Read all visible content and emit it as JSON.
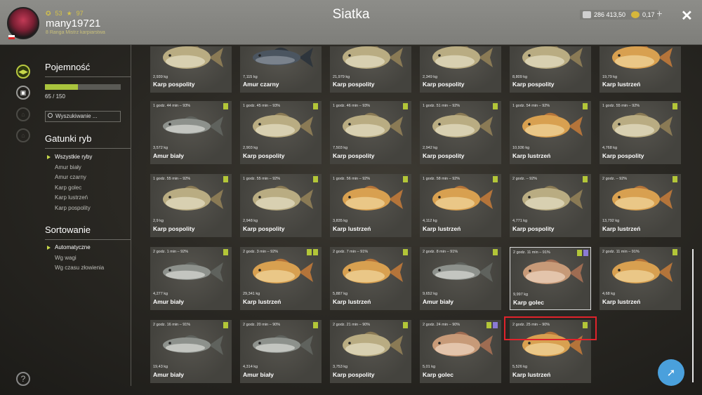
{
  "header": {
    "stat1": "53",
    "stat2": "97",
    "username": "many19721",
    "rank": "8 Ranga Mistrz karpiarstwa",
    "title": "Siatka",
    "silver": "286 413,50",
    "gold": "0,17",
    "plus": "+",
    "close": "✕"
  },
  "sidebar": {
    "capacity_title": "Pojemność",
    "capacity_count": "65 / 150",
    "capacity_fraction": 0.4333,
    "search_placeholder": "Wyszukiwanie ...",
    "species_title": "Gatunki ryb",
    "species": [
      "Wszystkie ryby",
      "Amur biały",
      "Amur czarny",
      "Karp golec",
      "Karp lustrzeń",
      "Karp pospolity"
    ],
    "sort_title": "Sortowanie",
    "sorts": [
      "Automatyczne",
      "Wg wagi",
      "Wg czasu złowienia"
    ]
  },
  "colors": {
    "accent": "#b3c638",
    "purple": "#8b7ad4",
    "highlight": "#e0232b",
    "fab": "#4aa0dc"
  },
  "cards": [
    {
      "time": "",
      "weight": "2,939 kg",
      "name": "Karp pospolity",
      "fish": "common",
      "tags": []
    },
    {
      "time": "",
      "weight": "7,115 kg",
      "name": "Amur czarny",
      "fish": "black",
      "tags": []
    },
    {
      "time": "",
      "weight": "21,979 kg",
      "name": "Karp pospolity",
      "fish": "common",
      "tags": []
    },
    {
      "time": "",
      "weight": "2,349 kg",
      "name": "Karp pospolity",
      "fish": "common",
      "tags": []
    },
    {
      "time": "",
      "weight": "8,809 kg",
      "name": "Karp pospolity",
      "fish": "common",
      "tags": []
    },
    {
      "time": "",
      "weight": "19,79 kg",
      "name": "Karp lustrzeń",
      "fish": "mirror",
      "tags": []
    },
    {
      "time": "1 godz. 44 min – 93%",
      "weight": "3,572 kg",
      "name": "Amur biały",
      "fish": "grass",
      "tags": [
        "g"
      ]
    },
    {
      "time": "1 godz. 45 min – 93%",
      "weight": "2,903 kg",
      "name": "Karp pospolity",
      "fish": "common",
      "tags": [
        "g"
      ]
    },
    {
      "time": "1 godz. 46 min – 93%",
      "weight": "7,503 kg",
      "name": "Karp pospolity",
      "fish": "common",
      "tags": [
        "g"
      ]
    },
    {
      "time": "1 godz. 51 min – 92%",
      "weight": "2,942 kg",
      "name": "Karp pospolity",
      "fish": "common",
      "tags": [
        "g"
      ]
    },
    {
      "time": "1 godz. 54 min – 92%",
      "weight": "10,936 kg",
      "name": "Karp lustrzeń",
      "fish": "mirror",
      "tags": [
        "g"
      ]
    },
    {
      "time": "1 godz. 55 min – 92%",
      "weight": "4,768 kg",
      "name": "Karp pospolity",
      "fish": "common",
      "tags": [
        "g"
      ]
    },
    {
      "time": "1 godz. 55 min – 92%",
      "weight": "2,9 kg",
      "name": "Karp pospolity",
      "fish": "common",
      "tags": [
        "g"
      ]
    },
    {
      "time": "1 godz. 55 min – 92%",
      "weight": "2,948 kg",
      "name": "Karp pospolity",
      "fish": "common",
      "tags": [
        "g"
      ]
    },
    {
      "time": "1 godz. 56 min – 92%",
      "weight": "3,835 kg",
      "name": "Karp lustrzeń",
      "fish": "mirror",
      "tags": [
        "g"
      ]
    },
    {
      "time": "1 godz. 58 min – 92%",
      "weight": "4,112 kg",
      "name": "Karp lustrzeń",
      "fish": "mirror",
      "tags": [
        "g"
      ]
    },
    {
      "time": "2 godz. – 92%",
      "weight": "4,771 kg",
      "name": "Karp pospolity",
      "fish": "common",
      "tags": [
        "g"
      ]
    },
    {
      "time": "2 godz. – 92%",
      "weight": "13,792 kg",
      "name": "Karp lustrzeń",
      "fish": "mirror",
      "tags": [
        "g"
      ]
    },
    {
      "time": "2 godz. 1 min – 92%",
      "weight": "4,277 kg",
      "name": "Amur biały",
      "fish": "grass",
      "tags": [
        "g"
      ]
    },
    {
      "time": "2 godz. 3 min – 92%",
      "weight": "29,341 kg",
      "name": "Karp lustrzeń",
      "fish": "mirror",
      "tags": [
        "g",
        "g"
      ]
    },
    {
      "time": "2 godz. 7 min – 91%",
      "weight": "5,887 kg",
      "name": "Karp lustrzeń",
      "fish": "mirror",
      "tags": [
        "g"
      ]
    },
    {
      "time": "2 godz. 8 min – 91%",
      "weight": "9,652 kg",
      "name": "Amur biały",
      "fish": "grass",
      "tags": [
        "g"
      ]
    },
    {
      "time": "2 godz. 11 min – 91%",
      "weight": "9,997 kg",
      "name": "Karp golec",
      "fish": "leather",
      "tags": [
        "g",
        "p"
      ],
      "selected": true
    },
    {
      "time": "2 godz. 11 min – 91%",
      "weight": "4,68 kg",
      "name": "Karp lustrzeń",
      "fish": "mirror",
      "tags": [
        "g"
      ]
    },
    {
      "time": "2 godz. 16 min – 91%",
      "weight": "19,43 kg",
      "name": "Amur biały",
      "fish": "grass",
      "tags": [
        "g"
      ]
    },
    {
      "time": "2 godz. 20 min – 90%",
      "weight": "4,314 kg",
      "name": "Amur biały",
      "fish": "grass",
      "tags": [
        "g"
      ]
    },
    {
      "time": "2 godz. 21 min – 90%",
      "weight": "3,753 kg",
      "name": "Karp pospolity",
      "fish": "common",
      "tags": [
        "g"
      ]
    },
    {
      "time": "2 godz. 24 min – 90%",
      "weight": "5,01 kg",
      "name": "Karp golec",
      "fish": "leather",
      "tags": [
        "g",
        "p"
      ]
    },
    {
      "time": "2 godz. 25 min – 90%",
      "weight": "5,526 kg",
      "name": "Karp lustrzeń",
      "fish": "mirror",
      "tags": [
        "g"
      ]
    }
  ]
}
